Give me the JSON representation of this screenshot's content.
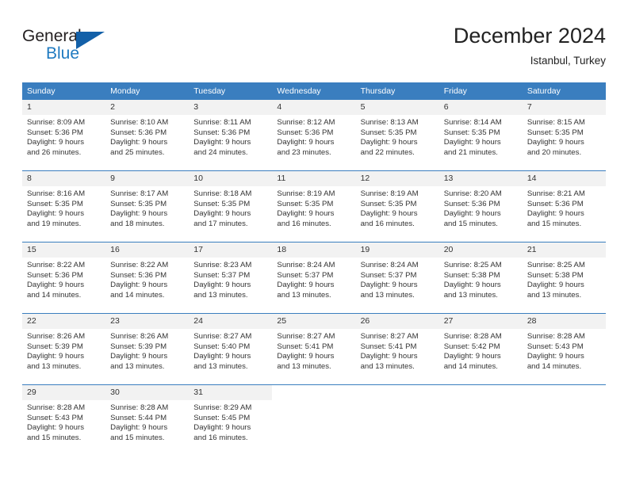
{
  "brand": {
    "name_part1": "General",
    "name_part2": "Blue",
    "triangle_color": "#1360a8",
    "blue_color": "#1f7ac0"
  },
  "header": {
    "title": "December 2024",
    "subtitle": "Istanbul, Turkey"
  },
  "theme": {
    "header_bg": "#3a7ebf",
    "header_text": "#ffffff",
    "daynum_bg": "#f2f2f2",
    "body_text": "#333333",
    "row_divider": "#3a7ebf"
  },
  "weekdays": [
    "Sunday",
    "Monday",
    "Tuesday",
    "Wednesday",
    "Thursday",
    "Friday",
    "Saturday"
  ],
  "weeks": [
    [
      {
        "day": "1",
        "sunrise": "Sunrise: 8:09 AM",
        "sunset": "Sunset: 5:36 PM",
        "daylight1": "Daylight: 9 hours",
        "daylight2": "and 26 minutes."
      },
      {
        "day": "2",
        "sunrise": "Sunrise: 8:10 AM",
        "sunset": "Sunset: 5:36 PM",
        "daylight1": "Daylight: 9 hours",
        "daylight2": "and 25 minutes."
      },
      {
        "day": "3",
        "sunrise": "Sunrise: 8:11 AM",
        "sunset": "Sunset: 5:36 PM",
        "daylight1": "Daylight: 9 hours",
        "daylight2": "and 24 minutes."
      },
      {
        "day": "4",
        "sunrise": "Sunrise: 8:12 AM",
        "sunset": "Sunset: 5:36 PM",
        "daylight1": "Daylight: 9 hours",
        "daylight2": "and 23 minutes."
      },
      {
        "day": "5",
        "sunrise": "Sunrise: 8:13 AM",
        "sunset": "Sunset: 5:35 PM",
        "daylight1": "Daylight: 9 hours",
        "daylight2": "and 22 minutes."
      },
      {
        "day": "6",
        "sunrise": "Sunrise: 8:14 AM",
        "sunset": "Sunset: 5:35 PM",
        "daylight1": "Daylight: 9 hours",
        "daylight2": "and 21 minutes."
      },
      {
        "day": "7",
        "sunrise": "Sunrise: 8:15 AM",
        "sunset": "Sunset: 5:35 PM",
        "daylight1": "Daylight: 9 hours",
        "daylight2": "and 20 minutes."
      }
    ],
    [
      {
        "day": "8",
        "sunrise": "Sunrise: 8:16 AM",
        "sunset": "Sunset: 5:35 PM",
        "daylight1": "Daylight: 9 hours",
        "daylight2": "and 19 minutes."
      },
      {
        "day": "9",
        "sunrise": "Sunrise: 8:17 AM",
        "sunset": "Sunset: 5:35 PM",
        "daylight1": "Daylight: 9 hours",
        "daylight2": "and 18 minutes."
      },
      {
        "day": "10",
        "sunrise": "Sunrise: 8:18 AM",
        "sunset": "Sunset: 5:35 PM",
        "daylight1": "Daylight: 9 hours",
        "daylight2": "and 17 minutes."
      },
      {
        "day": "11",
        "sunrise": "Sunrise: 8:19 AM",
        "sunset": "Sunset: 5:35 PM",
        "daylight1": "Daylight: 9 hours",
        "daylight2": "and 16 minutes."
      },
      {
        "day": "12",
        "sunrise": "Sunrise: 8:19 AM",
        "sunset": "Sunset: 5:35 PM",
        "daylight1": "Daylight: 9 hours",
        "daylight2": "and 16 minutes."
      },
      {
        "day": "13",
        "sunrise": "Sunrise: 8:20 AM",
        "sunset": "Sunset: 5:36 PM",
        "daylight1": "Daylight: 9 hours",
        "daylight2": "and 15 minutes."
      },
      {
        "day": "14",
        "sunrise": "Sunrise: 8:21 AM",
        "sunset": "Sunset: 5:36 PM",
        "daylight1": "Daylight: 9 hours",
        "daylight2": "and 15 minutes."
      }
    ],
    [
      {
        "day": "15",
        "sunrise": "Sunrise: 8:22 AM",
        "sunset": "Sunset: 5:36 PM",
        "daylight1": "Daylight: 9 hours",
        "daylight2": "and 14 minutes."
      },
      {
        "day": "16",
        "sunrise": "Sunrise: 8:22 AM",
        "sunset": "Sunset: 5:36 PM",
        "daylight1": "Daylight: 9 hours",
        "daylight2": "and 14 minutes."
      },
      {
        "day": "17",
        "sunrise": "Sunrise: 8:23 AM",
        "sunset": "Sunset: 5:37 PM",
        "daylight1": "Daylight: 9 hours",
        "daylight2": "and 13 minutes."
      },
      {
        "day": "18",
        "sunrise": "Sunrise: 8:24 AM",
        "sunset": "Sunset: 5:37 PM",
        "daylight1": "Daylight: 9 hours",
        "daylight2": "and 13 minutes."
      },
      {
        "day": "19",
        "sunrise": "Sunrise: 8:24 AM",
        "sunset": "Sunset: 5:37 PM",
        "daylight1": "Daylight: 9 hours",
        "daylight2": "and 13 minutes."
      },
      {
        "day": "20",
        "sunrise": "Sunrise: 8:25 AM",
        "sunset": "Sunset: 5:38 PM",
        "daylight1": "Daylight: 9 hours",
        "daylight2": "and 13 minutes."
      },
      {
        "day": "21",
        "sunrise": "Sunrise: 8:25 AM",
        "sunset": "Sunset: 5:38 PM",
        "daylight1": "Daylight: 9 hours",
        "daylight2": "and 13 minutes."
      }
    ],
    [
      {
        "day": "22",
        "sunrise": "Sunrise: 8:26 AM",
        "sunset": "Sunset: 5:39 PM",
        "daylight1": "Daylight: 9 hours",
        "daylight2": "and 13 minutes."
      },
      {
        "day": "23",
        "sunrise": "Sunrise: 8:26 AM",
        "sunset": "Sunset: 5:39 PM",
        "daylight1": "Daylight: 9 hours",
        "daylight2": "and 13 minutes."
      },
      {
        "day": "24",
        "sunrise": "Sunrise: 8:27 AM",
        "sunset": "Sunset: 5:40 PM",
        "daylight1": "Daylight: 9 hours",
        "daylight2": "and 13 minutes."
      },
      {
        "day": "25",
        "sunrise": "Sunrise: 8:27 AM",
        "sunset": "Sunset: 5:41 PM",
        "daylight1": "Daylight: 9 hours",
        "daylight2": "and 13 minutes."
      },
      {
        "day": "26",
        "sunrise": "Sunrise: 8:27 AM",
        "sunset": "Sunset: 5:41 PM",
        "daylight1": "Daylight: 9 hours",
        "daylight2": "and 13 minutes."
      },
      {
        "day": "27",
        "sunrise": "Sunrise: 8:28 AM",
        "sunset": "Sunset: 5:42 PM",
        "daylight1": "Daylight: 9 hours",
        "daylight2": "and 14 minutes."
      },
      {
        "day": "28",
        "sunrise": "Sunrise: 8:28 AM",
        "sunset": "Sunset: 5:43 PM",
        "daylight1": "Daylight: 9 hours",
        "daylight2": "and 14 minutes."
      }
    ],
    [
      {
        "day": "29",
        "sunrise": "Sunrise: 8:28 AM",
        "sunset": "Sunset: 5:43 PM",
        "daylight1": "Daylight: 9 hours",
        "daylight2": "and 15 minutes."
      },
      {
        "day": "30",
        "sunrise": "Sunrise: 8:28 AM",
        "sunset": "Sunset: 5:44 PM",
        "daylight1": "Daylight: 9 hours",
        "daylight2": "and 15 minutes."
      },
      {
        "day": "31",
        "sunrise": "Sunrise: 8:29 AM",
        "sunset": "Sunset: 5:45 PM",
        "daylight1": "Daylight: 9 hours",
        "daylight2": "and 16 minutes."
      },
      {
        "day": "",
        "sunrise": "",
        "sunset": "",
        "daylight1": "",
        "daylight2": ""
      },
      {
        "day": "",
        "sunrise": "",
        "sunset": "",
        "daylight1": "",
        "daylight2": ""
      },
      {
        "day": "",
        "sunrise": "",
        "sunset": "",
        "daylight1": "",
        "daylight2": ""
      },
      {
        "day": "",
        "sunrise": "",
        "sunset": "",
        "daylight1": "",
        "daylight2": ""
      }
    ]
  ]
}
